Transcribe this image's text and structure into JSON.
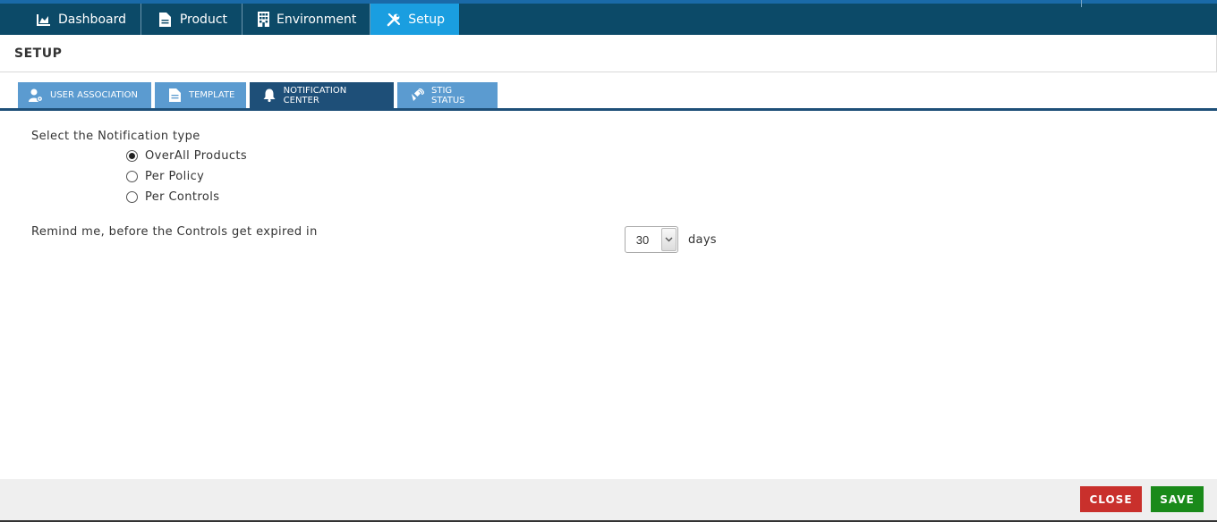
{
  "nav": {
    "tabs": [
      {
        "label": "Dashboard",
        "icon": "chart-area-icon"
      },
      {
        "label": "Product",
        "icon": "document-icon"
      },
      {
        "label": "Environment",
        "icon": "building-icon"
      },
      {
        "label": "Setup",
        "icon": "tools-icon",
        "active": true
      }
    ]
  },
  "page": {
    "title": "SETUP"
  },
  "subtabs": [
    {
      "label": "USER ASSOCIATION",
      "icon": "user-gear-icon"
    },
    {
      "label": "TEMPLATE",
      "icon": "document-icon"
    },
    {
      "label": "NOTIFICATION CENTER",
      "icon": "bell-icon",
      "active": true
    },
    {
      "label": "STIG STATUS",
      "icon": "satellite-icon"
    }
  ],
  "notification": {
    "type_label": "Select the Notification type",
    "options": [
      {
        "label": "OverAll Products",
        "checked": true
      },
      {
        "label": "Per Policy",
        "checked": false
      },
      {
        "label": "Per Controls",
        "checked": false
      }
    ],
    "remind_label": "Remind me, before the Controls get expired in",
    "days_value": "30",
    "days_unit": "days"
  },
  "footer": {
    "close_label": "CLOSE",
    "save_label": "SAVE"
  },
  "colors": {
    "nav_bg": "#0c4a68",
    "nav_active": "#1a9ee0",
    "subtab": "#5b9bd0",
    "subtab_active": "#1e4f78",
    "close": "#c9302c",
    "save": "#1a8a1a"
  }
}
